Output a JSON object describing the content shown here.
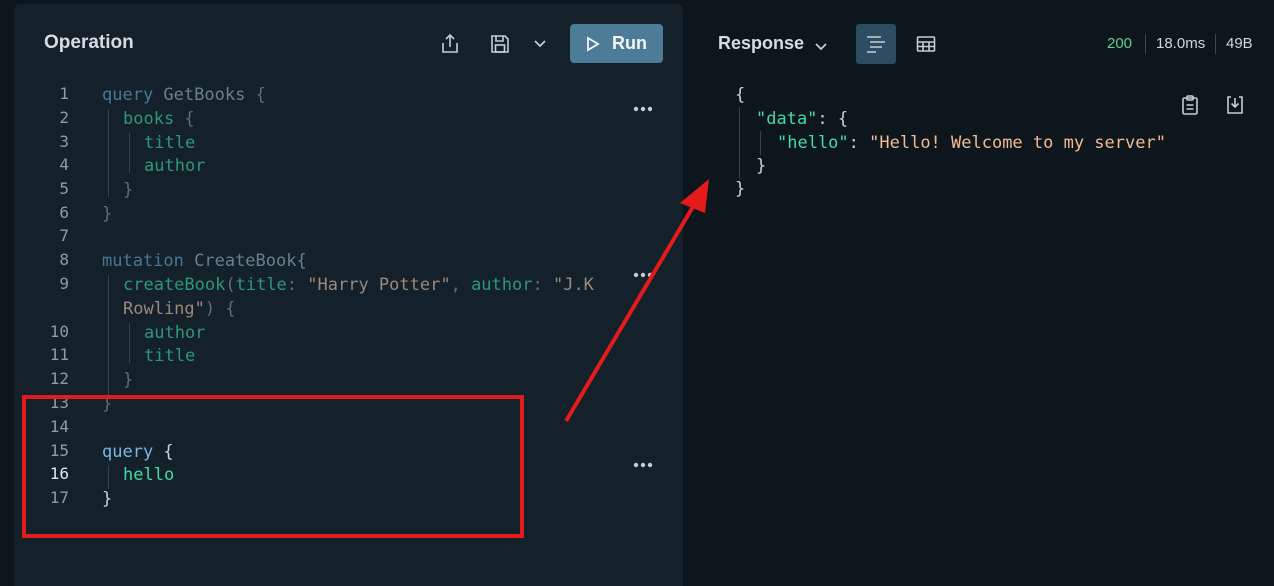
{
  "operation": {
    "title": "Operation",
    "run_label": "Run",
    "lines": [
      {
        "n": "1"
      },
      {
        "n": "2"
      },
      {
        "n": "3"
      },
      {
        "n": "4"
      },
      {
        "n": "5"
      },
      {
        "n": "6"
      },
      {
        "n": "7"
      },
      {
        "n": "8"
      },
      {
        "n": "9"
      },
      {
        "n": "10"
      },
      {
        "n": "11"
      },
      {
        "n": "12"
      },
      {
        "n": "13"
      },
      {
        "n": "14"
      },
      {
        "n": "15"
      },
      {
        "n": "16"
      },
      {
        "n": "17"
      }
    ],
    "code": {
      "q1_kw": "query",
      "q1_name": " GetBooks",
      "q1_open": " {",
      "books": "books",
      "books_open": " {",
      "title1": "title",
      "author1": "author",
      "close_inner1": "}",
      "close_outer1": "}",
      "m_kw": "mutation",
      "m_name": " CreateBook{",
      "create_fn": "createBook",
      "create_p1": "(",
      "arg_title": "title",
      "colon1": ": ",
      "val_title": "\"Harry Potter\"",
      "comma": ", ",
      "arg_author": "author",
      "colon2": ": ",
      "val_author_a": "\"J.K",
      "val_author_b": "Rowling\"",
      "create_close": ") {",
      "author2": "author",
      "title2": "title",
      "close_inner2": "}",
      "close_outer2": "}",
      "q3_kw": "query",
      "q3_open": " {",
      "hello": "hello",
      "close_outer3": "}"
    }
  },
  "response": {
    "title": "Response",
    "status": "200",
    "time": "18.0ms",
    "size": "49B",
    "json": {
      "open": "{",
      "data_key": "\"data\"",
      "data_colon": ": {",
      "hello_key": "\"hello\"",
      "hello_colon": ": ",
      "hello_val": "\"Hello! Welcome to my server\"",
      "inner_close": "}",
      "outer_close": "}"
    }
  },
  "colors": {
    "run_button": "#4c7c97",
    "status_ok": "#5fd18b",
    "annotation": "#e31b1b"
  },
  "icons": [
    "share-icon",
    "save-icon",
    "chevron-down-icon",
    "play-icon",
    "more-icon",
    "list-view-icon",
    "table-view-icon",
    "copy-icon",
    "download-icon"
  ]
}
